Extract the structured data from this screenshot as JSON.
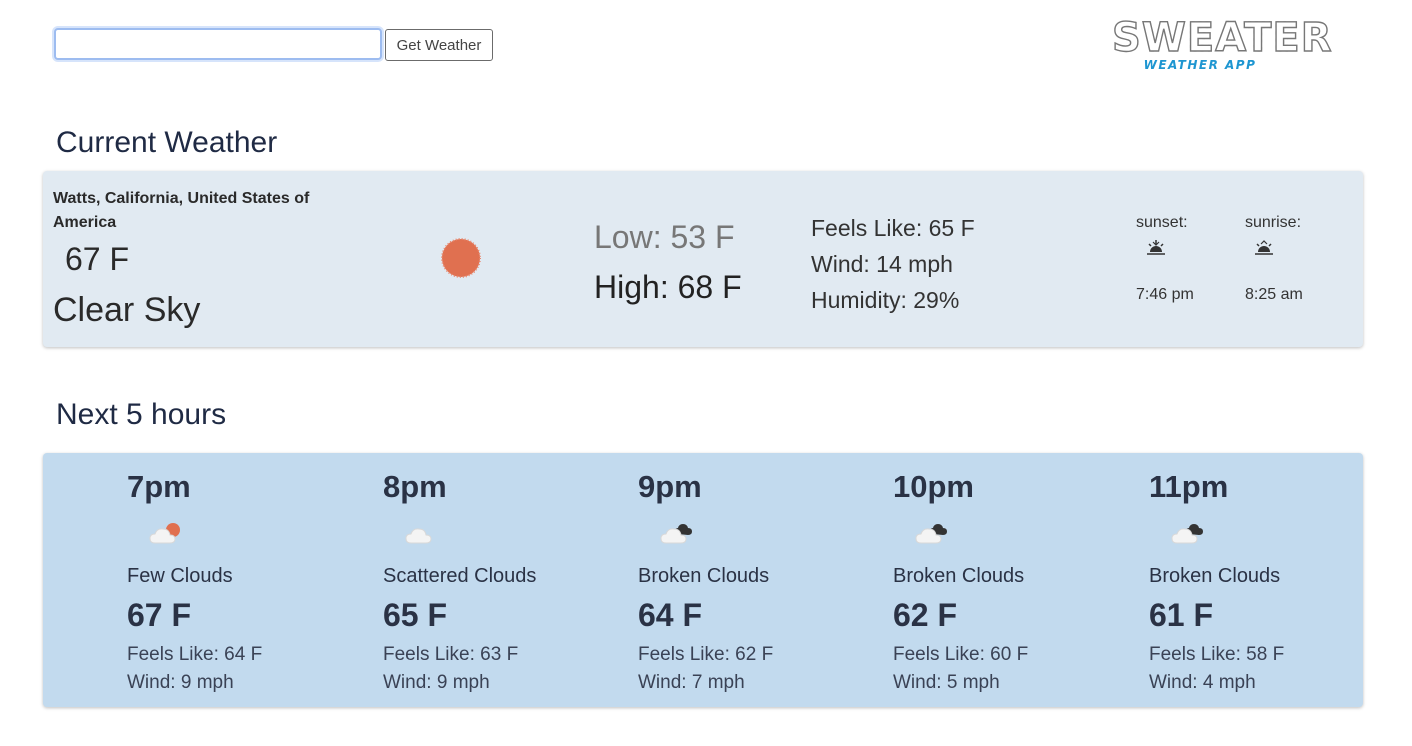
{
  "search": {
    "value": "",
    "placeholder": "",
    "button_label": "Get Weather"
  },
  "logo": {
    "main": "SWEATER",
    "sub": "WEATHER APP"
  },
  "current": {
    "heading": "Current Weather",
    "location": "Watts, California, United States of America",
    "temp": "67 F",
    "description": "Clear Sky",
    "icon": "clear-sun-icon",
    "low": "Low: 53 F",
    "high": "High: 68 F",
    "feels_like": "Feels Like: 65 F",
    "wind": "Wind: 14 mph",
    "humidity": "Humidity: 29%",
    "sunset_label": "sunset:",
    "sunset_time": "7:46 pm",
    "sunrise_label": "sunrise:",
    "sunrise_time": "8:25 am"
  },
  "hourly": {
    "heading": "Next 5 hours",
    "items": [
      {
        "time": "7pm",
        "icon": "few-clouds-icon",
        "description": "Few Clouds",
        "temp": "67 F",
        "feels_like": "Feels Like: 64 F",
        "wind": "Wind: 9 mph"
      },
      {
        "time": "8pm",
        "icon": "scattered-clouds-icon",
        "description": "Scattered Clouds",
        "temp": "65 F",
        "feels_like": "Feels Like: 63 F",
        "wind": "Wind: 9 mph"
      },
      {
        "time": "9pm",
        "icon": "broken-clouds-icon",
        "description": "Broken Clouds",
        "temp": "64 F",
        "feels_like": "Feels Like: 62 F",
        "wind": "Wind: 7 mph"
      },
      {
        "time": "10pm",
        "icon": "broken-clouds-icon",
        "description": "Broken Clouds",
        "temp": "62 F",
        "feels_like": "Feels Like: 60 F",
        "wind": "Wind: 5 mph"
      },
      {
        "time": "11pm",
        "icon": "broken-clouds-icon",
        "description": "Broken Clouds",
        "temp": "61 F",
        "feels_like": "Feels Like: 58 F",
        "wind": "Wind: 4 mph"
      }
    ]
  },
  "colors": {
    "current_card_bg": "#e1eaf2",
    "hourly_card_bg": "#c2daee",
    "sun": "#e07050",
    "logo_accent": "#1e96d1"
  }
}
